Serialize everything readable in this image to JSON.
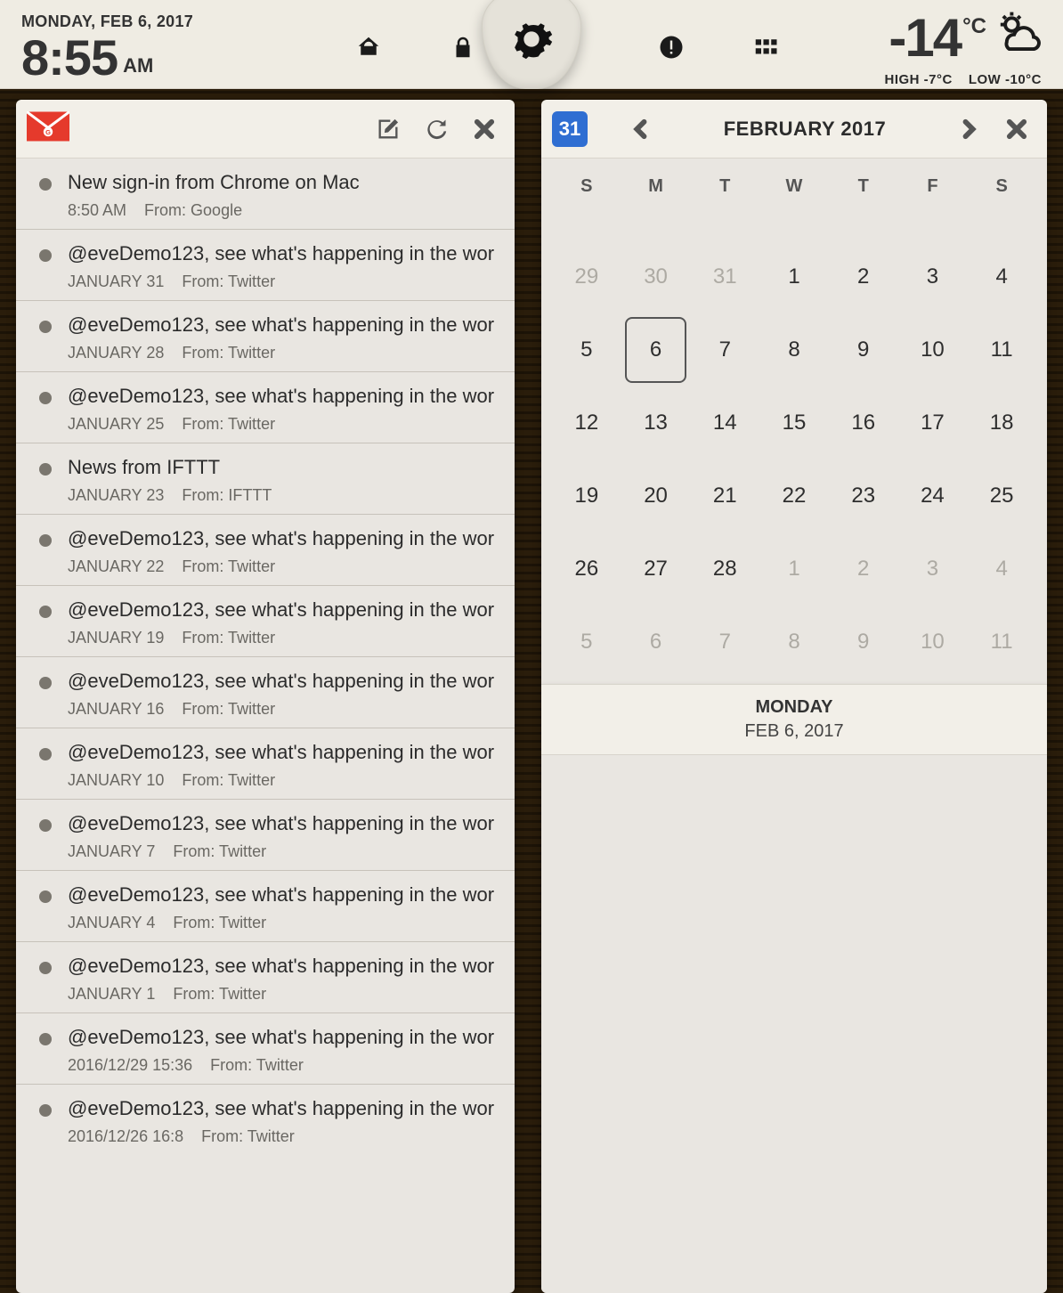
{
  "status": {
    "date_label": "MONDAY, FEB 6, 2017",
    "time": "8:55",
    "meridiem": "AM",
    "temp_value": "-14",
    "temp_unit": "°C",
    "high_label": "HIGH -7°C",
    "low_label": "LOW -10°C"
  },
  "mail": {
    "items": [
      {
        "subject": "New sign-in from Chrome on Mac",
        "date": "8:50 AM",
        "from": "From: Google"
      },
      {
        "subject": "@eveDemo123, see what's happening in the wor",
        "date": "JANUARY 31",
        "from": "From: Twitter"
      },
      {
        "subject": "@eveDemo123, see what's happening in the wor",
        "date": "JANUARY 28",
        "from": "From: Twitter"
      },
      {
        "subject": "@eveDemo123, see what's happening in the wor",
        "date": "JANUARY 25",
        "from": "From: Twitter"
      },
      {
        "subject": "News from IFTTT",
        "date": "JANUARY 23",
        "from": "From: IFTTT"
      },
      {
        "subject": "@eveDemo123, see what's happening in the wor",
        "date": "JANUARY 22",
        "from": "From: Twitter"
      },
      {
        "subject": "@eveDemo123, see what's happening in the wor",
        "date": "JANUARY 19",
        "from": "From: Twitter"
      },
      {
        "subject": "@eveDemo123, see what's happening in the wor",
        "date": "JANUARY 16",
        "from": "From: Twitter"
      },
      {
        "subject": "@eveDemo123, see what's happening in the wor",
        "date": "JANUARY 10",
        "from": "From: Twitter"
      },
      {
        "subject": "@eveDemo123, see what's happening in the wor",
        "date": "JANUARY 7",
        "from": "From: Twitter"
      },
      {
        "subject": "@eveDemo123, see what's happening in the wor",
        "date": "JANUARY 4",
        "from": "From: Twitter"
      },
      {
        "subject": "@eveDemo123, see what's happening in the wor",
        "date": "JANUARY 1",
        "from": "From: Twitter"
      },
      {
        "subject": "@eveDemo123, see what's happening in the wor",
        "date": "2016/12/29 15:36",
        "from": "From: Twitter"
      },
      {
        "subject": "@eveDemo123, see what's happening in the wor",
        "date": "2016/12/26 16:8",
        "from": "From: Twitter"
      }
    ]
  },
  "calendar": {
    "icon_badge": "31",
    "title": "FEBRUARY 2017",
    "weekdays": [
      "S",
      "M",
      "T",
      "W",
      "T",
      "F",
      "S"
    ],
    "weeks": [
      [
        {
          "n": "29",
          "out": true
        },
        {
          "n": "30",
          "out": true
        },
        {
          "n": "31",
          "out": true
        },
        {
          "n": "1"
        },
        {
          "n": "2"
        },
        {
          "n": "3"
        },
        {
          "n": "4"
        }
      ],
      [
        {
          "n": "5"
        },
        {
          "n": "6",
          "today": true
        },
        {
          "n": "7"
        },
        {
          "n": "8"
        },
        {
          "n": "9"
        },
        {
          "n": "10"
        },
        {
          "n": "11"
        }
      ],
      [
        {
          "n": "12"
        },
        {
          "n": "13"
        },
        {
          "n": "14"
        },
        {
          "n": "15"
        },
        {
          "n": "16"
        },
        {
          "n": "17"
        },
        {
          "n": "18"
        }
      ],
      [
        {
          "n": "19"
        },
        {
          "n": "20"
        },
        {
          "n": "21"
        },
        {
          "n": "22"
        },
        {
          "n": "23"
        },
        {
          "n": "24"
        },
        {
          "n": "25"
        }
      ],
      [
        {
          "n": "26"
        },
        {
          "n": "27"
        },
        {
          "n": "28"
        },
        {
          "n": "1",
          "out": true
        },
        {
          "n": "2",
          "out": true
        },
        {
          "n": "3",
          "out": true
        },
        {
          "n": "4",
          "out": true
        }
      ],
      [
        {
          "n": "5",
          "out": true
        },
        {
          "n": "6",
          "out": true
        },
        {
          "n": "7",
          "out": true
        },
        {
          "n": "8",
          "out": true
        },
        {
          "n": "9",
          "out": true
        },
        {
          "n": "10",
          "out": true
        },
        {
          "n": "11",
          "out": true
        }
      ]
    ],
    "detail_dayname": "MONDAY",
    "detail_date": "FEB 6, 2017"
  }
}
